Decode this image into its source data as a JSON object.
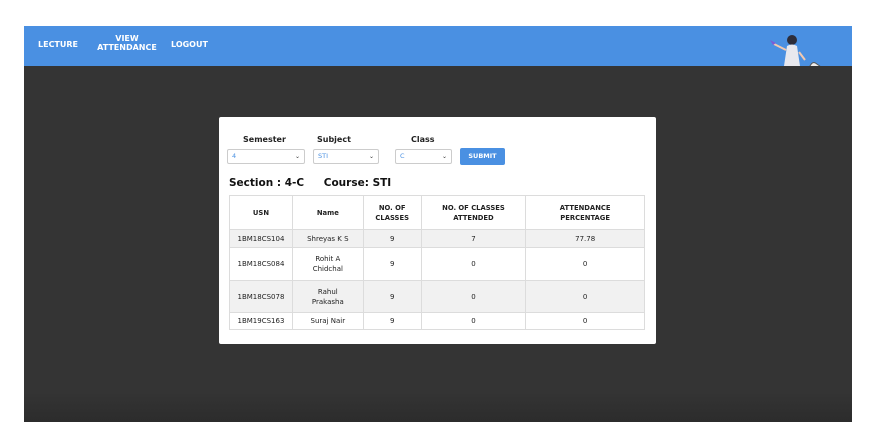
{
  "nav": {
    "lecture": "LECTURE",
    "view_attendance_line1": "VIEW",
    "view_attendance_line2": "ATTENDANCE",
    "logout": "LOGOUT"
  },
  "form": {
    "semester_label": "Semester",
    "subject_label": "Subject",
    "class_label": "Class",
    "semester_value": "4",
    "subject_value": "STI",
    "class_value": "C",
    "submit_label": "SUBMIT"
  },
  "summary": {
    "section": "Section : 4-C",
    "course": "Course: STI"
  },
  "table": {
    "headers": [
      [
        "USN"
      ],
      [
        "Name"
      ],
      [
        "NO. OF",
        "CLASSES"
      ],
      [
        "NO. OF CLASSES",
        "ATTENDED"
      ],
      [
        "ATTENDANCE",
        "PERCENTAGE"
      ]
    ],
    "rows": [
      {
        "usn": "1BM18CS104",
        "name_l1": "Shreyas K S",
        "name_l2": "",
        "classes": "9",
        "attended": "7",
        "percentage": "77.78"
      },
      {
        "usn": "1BM18CS084",
        "name_l1": "Rohit A",
        "name_l2": "Chidchal",
        "classes": "9",
        "attended": "0",
        "percentage": "0"
      },
      {
        "usn": "1BM18CS078",
        "name_l1": "Rahul",
        "name_l2": "Prakasha",
        "classes": "9",
        "attended": "0",
        "percentage": "0"
      },
      {
        "usn": "1BM19CS163",
        "name_l1": "Suraj Nair",
        "name_l2": "",
        "classes": "9",
        "attended": "0",
        "percentage": "0"
      }
    ]
  },
  "colors": {
    "accent": "#4a90e2",
    "background_dark": "#343434"
  },
  "icons": {
    "illustration": "student-on-book-illustration",
    "select_chevron": "chevron-down-icon"
  }
}
